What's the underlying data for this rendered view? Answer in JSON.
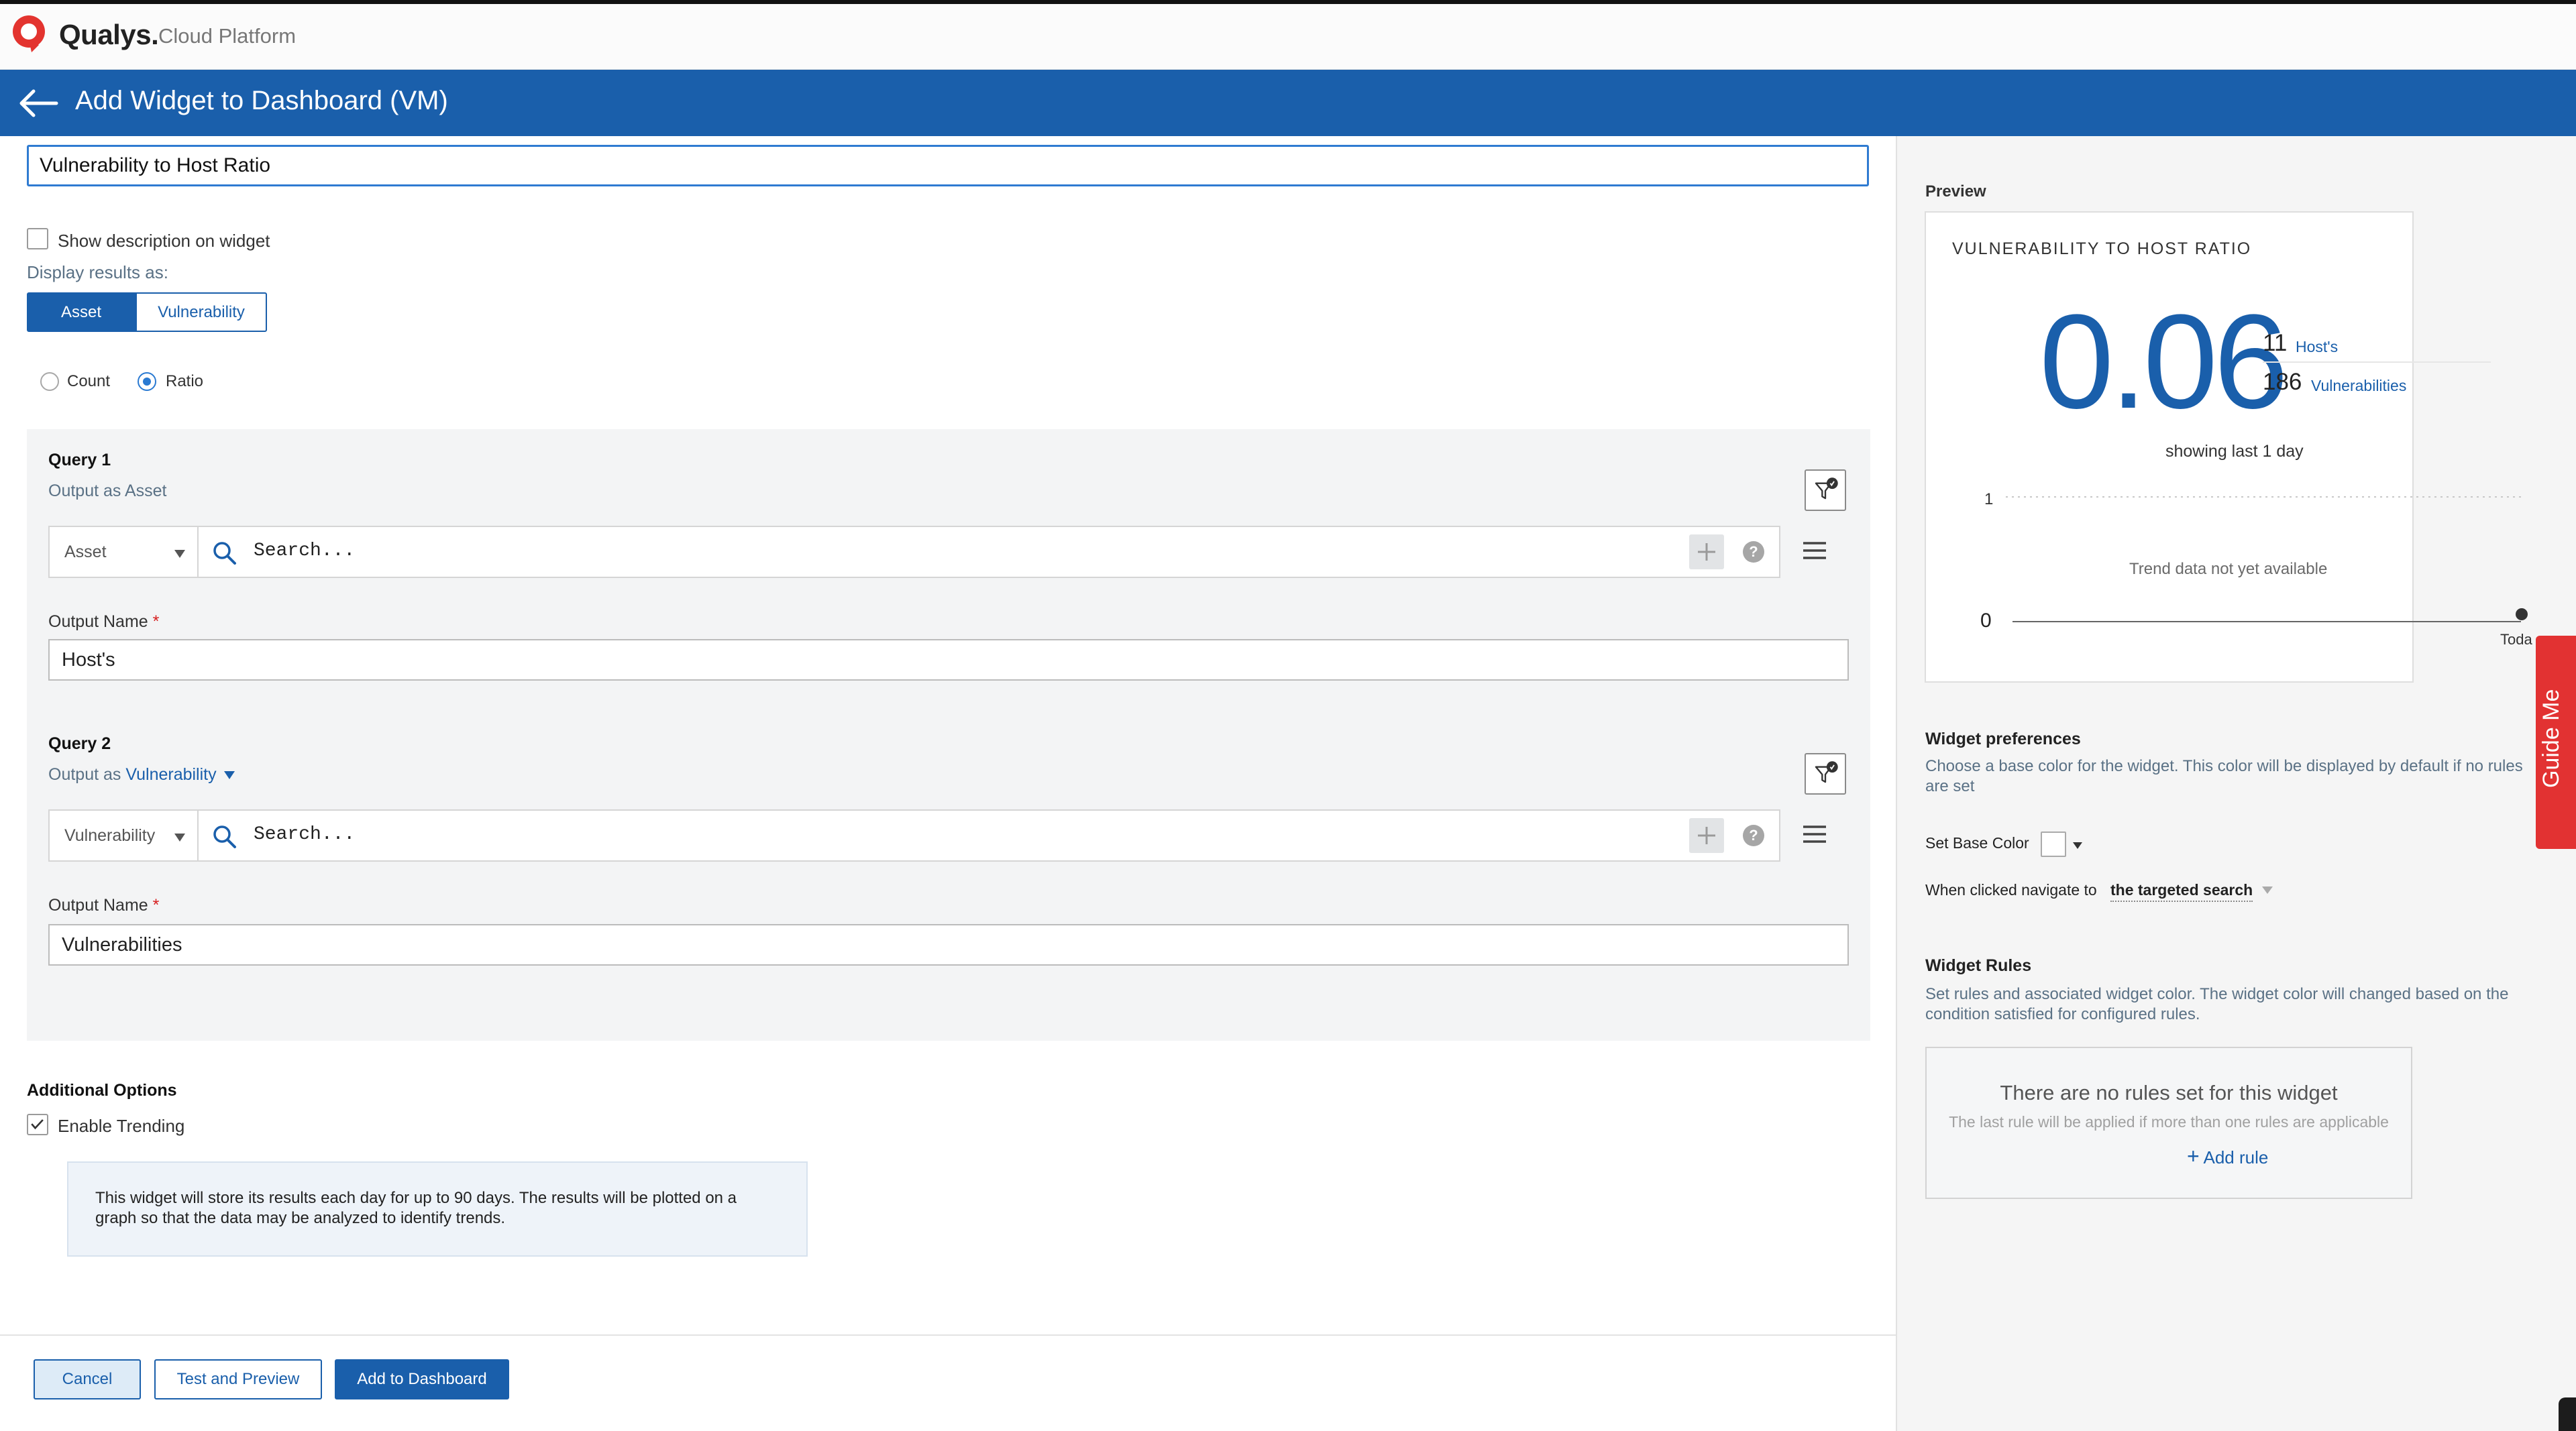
{
  "topbar": {
    "brand": "Qualys.",
    "brand_sub": "Cloud Platform"
  },
  "header": {
    "title": "Add Widget to Dashboard (VM)"
  },
  "form": {
    "widget_title_value": "Vulnerability to Host Ratio",
    "show_description_label": "Show description on widget",
    "show_description_checked": false,
    "display_results_label": "Display results as:",
    "display_options": [
      "Asset",
      "Vulnerability"
    ],
    "display_selected": "Asset",
    "mode_options": [
      "Count",
      "Ratio"
    ],
    "mode_selected": "Ratio"
  },
  "queries": [
    {
      "title": "Query 1",
      "output_as_prefix": "Output as Asset",
      "output_as_link": "",
      "select_value": "Asset",
      "search_placeholder": "Search...",
      "output_name_label": "Output Name",
      "required_mark": "*",
      "output_name_value": "Host's"
    },
    {
      "title": "Query 2",
      "output_as_prefix": "Output as",
      "output_as_link": "Vulnerability",
      "select_value": "Vulnerability",
      "search_placeholder": "Search...",
      "output_name_label": "Output Name",
      "required_mark": "*",
      "output_name_value": "Vulnerabilities"
    }
  ],
  "additional": {
    "heading": "Additional Options",
    "enable_trending_label": "Enable Trending",
    "enable_trending_checked": true,
    "info_text": "This widget will store its results each day for up to 90 days. The results will be plotted on a graph so that the data may be analyzed to identify trends."
  },
  "footer": {
    "cancel": "Cancel",
    "test_preview": "Test and Preview",
    "add_to_dashboard": "Add to Dashboard"
  },
  "preview": {
    "heading": "Preview",
    "card_title": "VULNERABILITY TO HOST RATIO",
    "ratio": "0.06",
    "stat1_value": "11",
    "stat1_label": "Host's",
    "stat2_value": "186",
    "stat2_label": "Vulnerabilities",
    "showing": "showing last 1 day",
    "axis_top": "1",
    "axis_bottom": "0",
    "trend_message": "Trend data not yet available",
    "today_label": "Toda"
  },
  "guide": {
    "label": "Guide Me"
  },
  "preferences": {
    "heading": "Widget preferences",
    "description": "Choose a base color for the widget. This color will be displayed by default if no rules are set",
    "base_color_label": "Set Base Color",
    "base_color": "#ffffff",
    "navigate_label": "When clicked navigate to",
    "navigate_value": "the targeted search"
  },
  "rules": {
    "heading": "Widget Rules",
    "description": "Set rules and associated widget color. The widget color will changed based on the condition satisfied for configured rules.",
    "empty_title": "There are no rules set for this widget",
    "empty_note": "The last rule will be applied if more than one rules are applicable",
    "add_rule": "Add rule"
  },
  "colors": {
    "brand_blue": "#1a5fab",
    "logo_red": "#e3342f",
    "guide_red": "#e23232"
  }
}
